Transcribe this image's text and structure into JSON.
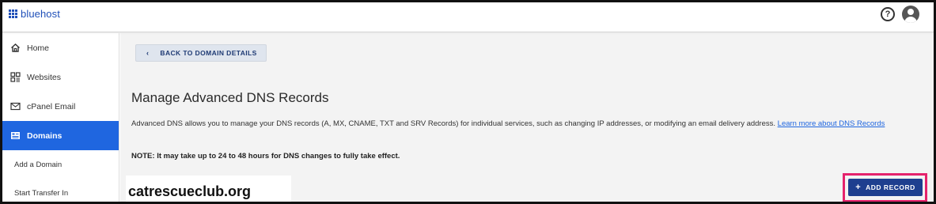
{
  "header": {
    "brand": "bluehost",
    "help_glyph": "?",
    "help_icon": "help-circle-icon",
    "avatar_icon": "user-avatar-icon"
  },
  "sidebar": {
    "items": [
      {
        "label": "Home",
        "icon": "home-icon",
        "active": false
      },
      {
        "label": "Websites",
        "icon": "websites-grid-icon",
        "active": false
      },
      {
        "label": "cPanel Email",
        "icon": "envelope-icon",
        "active": false
      },
      {
        "label": "Domains",
        "icon": "domains-icon",
        "active": true
      }
    ],
    "sub_items": [
      {
        "label": "Add a Domain"
      },
      {
        "label": "Start Transfer In"
      }
    ]
  },
  "main": {
    "back_button": {
      "chevron": "‹",
      "label": "BACK TO DOMAIN DETAILS"
    },
    "title": "Manage Advanced DNS Records",
    "description": "Advanced DNS allows you to manage your DNS records (A, MX, CNAME, TXT and SRV Records) for individual services, such as changing IP addresses, or modifying an email delivery address.",
    "learn_more_link": "Learn more about DNS Records",
    "note": "NOTE: It may take up to 24 to 48 hours for DNS changes to fully take effect.",
    "add_record_button": {
      "plus": "+",
      "label": "ADD RECORD"
    },
    "watermark": "catrescueclub.org"
  },
  "colors": {
    "brand_blue": "#1f4fb8",
    "active_nav": "#1f66e0",
    "add_button": "#1e3f8f",
    "highlight": "#e5226c",
    "main_bg": "#f3f3f3"
  }
}
